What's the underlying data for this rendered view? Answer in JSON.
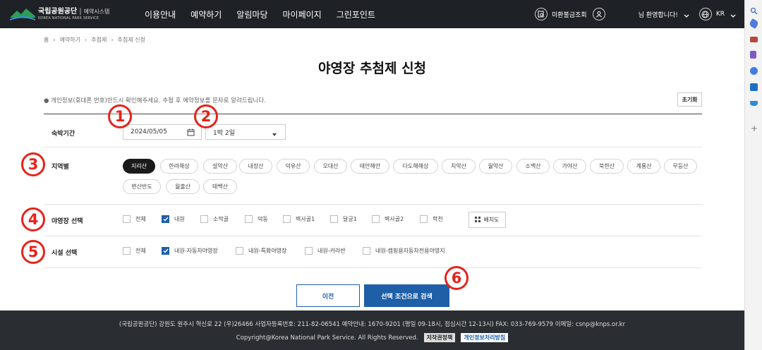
{
  "header": {
    "logo_title": "국립공원공단",
    "logo_sep": "|",
    "logo_reserve": "예약시스템",
    "logo_sub": "KOREA NATIONAL PARK SERVICE",
    "nav": [
      "이용안내",
      "예약하기",
      "알림마당",
      "마이페이지",
      "그린포인트"
    ],
    "refund_label": "미환불금조회",
    "welcome": "님 환영합니다!",
    "lang": "KR"
  },
  "breadcrumb": [
    "홈",
    "예약하기",
    "추첨제",
    "추첨제 신청"
  ],
  "page_title": "야영장 추첨제 신청",
  "notice": "● 개인정보(휴대폰 번호)반드시 확인해주세요. 추첨 후 예약정보를 문자로 알려드립니다.",
  "reset_label": "초기화",
  "stay": {
    "label": "숙박기간",
    "date": "2024/05/05",
    "nights": "1박 2일"
  },
  "region": {
    "label": "지역별",
    "items": [
      "지리산",
      "한려해상",
      "설악산",
      "내장산",
      "덕유산",
      "오대산",
      "태안해안",
      "다도해해상",
      "치악산",
      "월악산",
      "소백산",
      "가야산",
      "북한산",
      "계룡산",
      "무등산",
      "변산반도",
      "월출산",
      "태백산"
    ],
    "selected": "지리산"
  },
  "campsite": {
    "label": "야영장 선택",
    "items": [
      "전체",
      "내원",
      "소막골",
      "덕동",
      "벽사골1",
      "달궁1",
      "벽사골2",
      "학천"
    ],
    "checked": [
      "내원"
    ],
    "layout_label": "배치도"
  },
  "facility": {
    "label": "시설 선택",
    "items": [
      "전체",
      "내원-자동차야영장",
      "내원-특화야영장",
      "내원-카라반",
      "내원-캠핑용자동차전용야영지"
    ],
    "checked": [
      "내원-자동차야영장"
    ]
  },
  "buttons": {
    "prev": "이전",
    "search": "선택 조건으로 검색"
  },
  "markers": [
    "1",
    "2",
    "3",
    "4",
    "5",
    "6"
  ],
  "footer": {
    "line1": "(국립공원공단) 강원도 원주시 혁신로 22 (우)26466   사업자등록번호: 211-82-06541   예약안내: 1670-9201 (평일 09-18시, 점심시간 12-13시)   FAX: 033-769-9579   이메일: csnp@knps.or.kr",
    "copyright": "Copyright@Korea National Park Service. All Rights Reserved.",
    "copyright_policy": "저작권정책",
    "privacy_policy": "개인정보처리방침"
  },
  "colors": {
    "accent": "#1f5fa8",
    "header_bg": "#1e2126",
    "marker": "#e6231b"
  }
}
